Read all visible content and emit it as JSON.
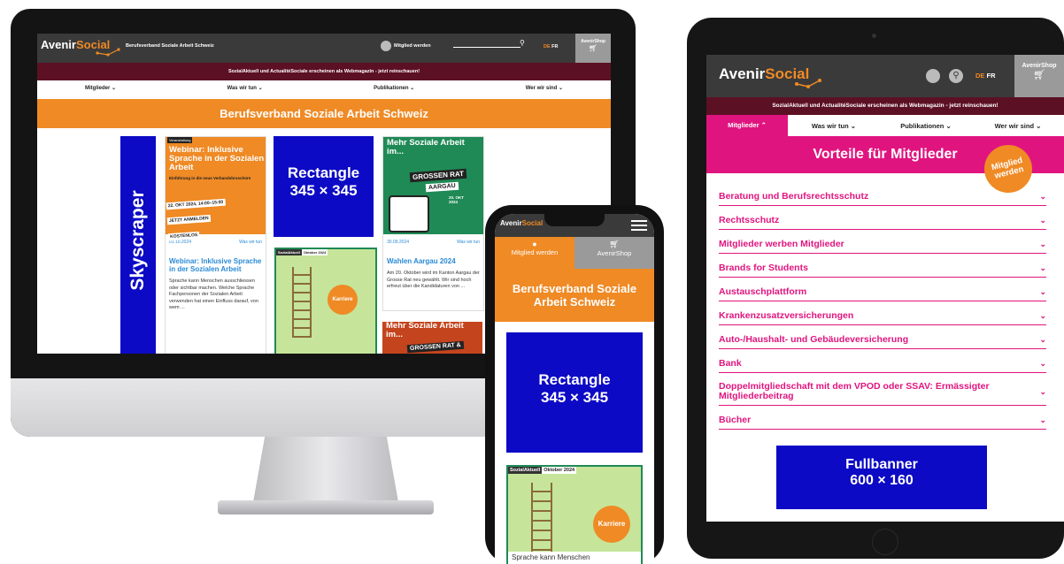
{
  "site": {
    "logo_a": "Avenir",
    "logo_b": "Social",
    "tagline": "Berufsverband Soziale Arbeit Schweiz",
    "member_link": "Mitglied werden",
    "lang_de": "DE",
    "lang_fr": "FR",
    "shop": "AvenirShop",
    "notice": "SozialAktuell und ActualitéSociale erscheinen als Webmagazin - jetzt reinschauen!",
    "nav": [
      "Mitglieder",
      "Was wir tun",
      "Publikationen",
      "Wer wir sind"
    ],
    "hero_title": "Berufsverband Soziale Arbeit Schweiz",
    "hero_title_mobile": "Berufsverband Soziale Arbeit Schweiz"
  },
  "ads": {
    "skyscraper": "Skyscraper",
    "rectangle_name": "Rectangle",
    "rectangle_size": "345 × 345",
    "fullbanner_name": "Fullbanner",
    "fullbanner_size": "600 × 160"
  },
  "cards": {
    "webinar": {
      "tag": "Veranstaltung",
      "poster_title": "Webinar: Inklusive Sprache in der Sozialen Arbeit",
      "poster_sub": "Einführung in die neue Verbandsbroschüre",
      "poster_date": "22. OKT 2024, 14:00–15:00",
      "poster_cta": "JETZT ANMELDEN",
      "poster_free": "KOSTENLOS",
      "date": "01.10.2024",
      "category": "Was wir tun",
      "title": "Webinar: Inklusive Sprache in der Sozialen Arbeit",
      "text": "Sprache kann Menschen ausschliessen oder sichtbar machen. Welche Sprache Fachpersonen der Sozialen Arbeit verwenden hat einen Einfluss darauf, von wem ..."
    },
    "aargau": {
      "poster_title": "Mehr Soziale Arbeit im...",
      "poster_big": "GROSSEN RAT",
      "poster_canton": "AARGAU",
      "poster_date": "20. OKT 2024",
      "date": "30.09.2024",
      "category": "Was wir tun",
      "title": "Wahlen Aargau 2024",
      "text": "Am 20. Oktober wird im Kanton Aargau der Grosse Rat neu gewählt. Wir sind hoch erfreut über die Kandidaturen von ..."
    },
    "magazine": {
      "label": "SozialAktuell",
      "issue": "Oktober 2024",
      "badge": "Karriere",
      "teaser": "Sprache kann Menschen"
    },
    "third": {
      "poster_title": "Mehr Soziale Arbeit im...",
      "poster_big": "GROSSEN RAT &"
    }
  },
  "tablet": {
    "section_title": "Vorteile für Mitglieder",
    "sticker": "Mitglied werden",
    "accordion": [
      "Beratung und Berufsrechtsschutz",
      "Rechtsschutz",
      "Mitglieder werben Mitglieder",
      "Brands for Students",
      "Austauschplattform",
      "Krankenzusatzversicherungen",
      "Auto-/Haushalt- und Gebäudeversicherung",
      "Bank",
      "Doppelmitgliedschaft mit dem VPOD oder SSAV: Ermässigter Mitgliederbeitrag",
      "Bücher"
    ]
  },
  "colors": {
    "orange": "#ef8a25",
    "magenta": "#e0147f",
    "ad_blue": "#0d0ac5",
    "header_grey": "#3a3a3a",
    "notice_maroon": "#5c1024"
  }
}
